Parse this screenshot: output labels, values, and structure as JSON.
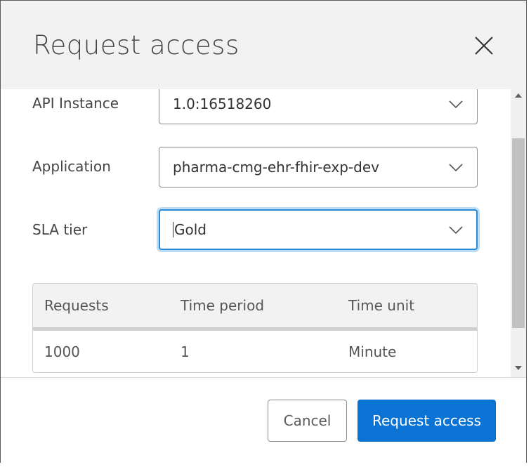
{
  "dialog": {
    "title": "Request access",
    "close_icon": "close-icon"
  },
  "form": {
    "api_instance": {
      "label": "API Instance",
      "value": "1.0:16518260"
    },
    "application": {
      "label": "Application",
      "value": "pharma-cmg-ehr-fhir-exp-dev"
    },
    "sla_tier": {
      "label": "SLA tier",
      "value": "Gold"
    },
    "dropdown_icon": "chevron-down-icon"
  },
  "sla_table": {
    "headers": [
      "Requests",
      "Time period",
      "Time unit"
    ],
    "rows": [
      [
        "1000",
        "1",
        "Minute"
      ]
    ]
  },
  "footer": {
    "cancel_label": "Cancel",
    "submit_label": "Request access"
  },
  "colors": {
    "primary": "#0b73d3",
    "focus": "#2a8ad6",
    "header_bg": "#f2f2f2"
  }
}
